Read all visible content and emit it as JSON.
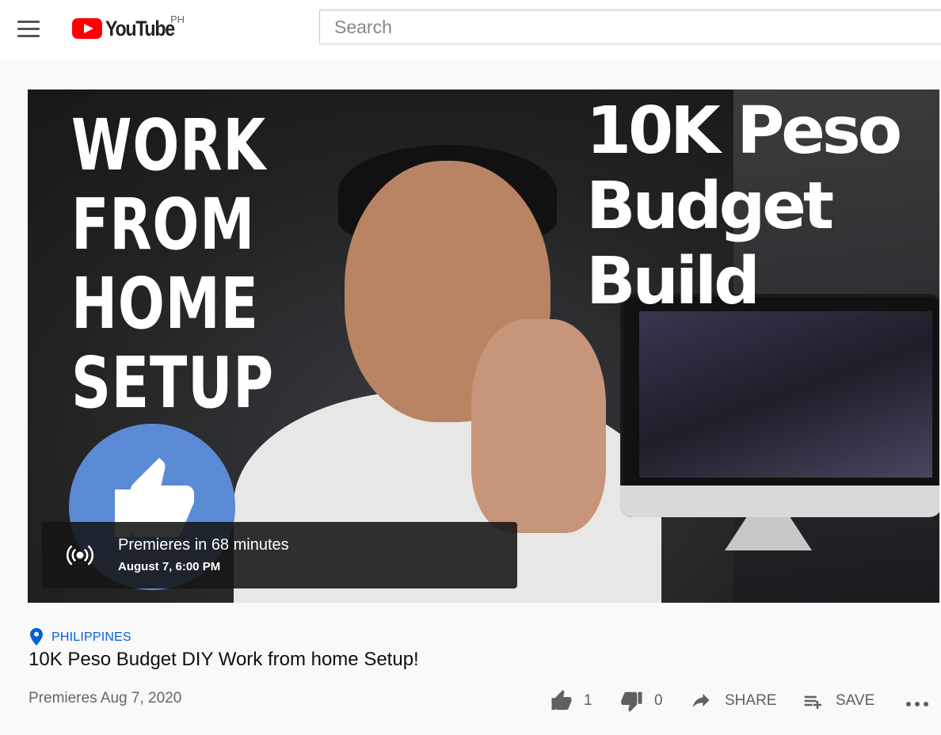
{
  "header": {
    "menu_icon": "hamburger-icon",
    "logo_text": "YouTube",
    "region": "PH",
    "search_placeholder": "Search"
  },
  "player": {
    "thumbnail_text_left": [
      "WORK",
      "FROM",
      "HOME",
      "SETUP"
    ],
    "thumbnail_text_right": [
      "10K Peso",
      "Budget",
      "Build"
    ],
    "premiere_status": "Premieres in 68 minutes",
    "premiere_datetime": "August 7, 6:00 PM",
    "premiere_icon": "broadcast-icon"
  },
  "video": {
    "location": "PHILIPPINES",
    "title": "10K Peso Budget DIY Work from home Setup!",
    "meta": "Premieres Aug 7, 2020"
  },
  "actions": {
    "likes": "1",
    "dislikes": "0",
    "share_label": "SHARE",
    "save_label": "SAVE",
    "colors": {
      "icon": "#606060",
      "link": "#065fd4",
      "logo_red": "#ff0000"
    }
  }
}
